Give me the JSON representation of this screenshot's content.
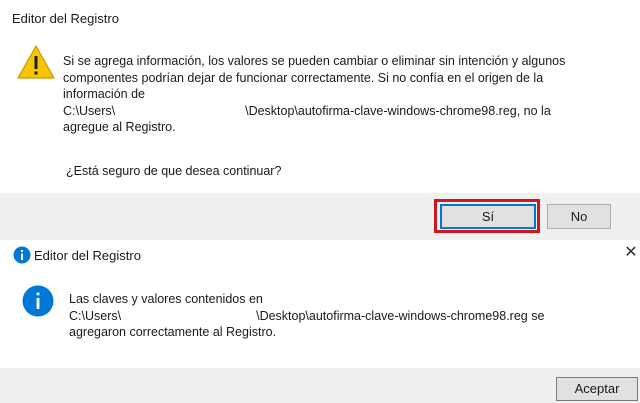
{
  "confirm_dialog": {
    "title": "Editor del Registro",
    "message_lines": [
      "Si se agrega información, los valores se pueden cambiar o eliminar sin intención y algunos",
      "componentes podrían dejar de funcionar correctamente. Si no confía en el origen de la",
      "información de",
      "C:\\Users\\",
      "\\Desktop\\autofirma-clave-windows-chrome98.reg, no la",
      "agregue al Registro."
    ],
    "question": "¿Está seguro de que desea continuar?",
    "yes_label": "Sí",
    "no_label": "No",
    "icon": "warning-icon"
  },
  "success_dialog": {
    "title": "Editor del Registro",
    "close_symbol": "✕",
    "message_lines": [
      "Las claves y valores contenidos en",
      "C:\\Users\\",
      "\\Desktop\\autofirma-clave-windows-chrome98.reg se",
      "agregaron correctamente al Registro."
    ],
    "accept_label": "Aceptar",
    "icon": "info-icon"
  },
  "colors": {
    "warning_yellow": "#f7c500",
    "info_blue": "#0078d7",
    "highlight_red": "#d0161f",
    "footer_gray": "#f0f0f0"
  }
}
